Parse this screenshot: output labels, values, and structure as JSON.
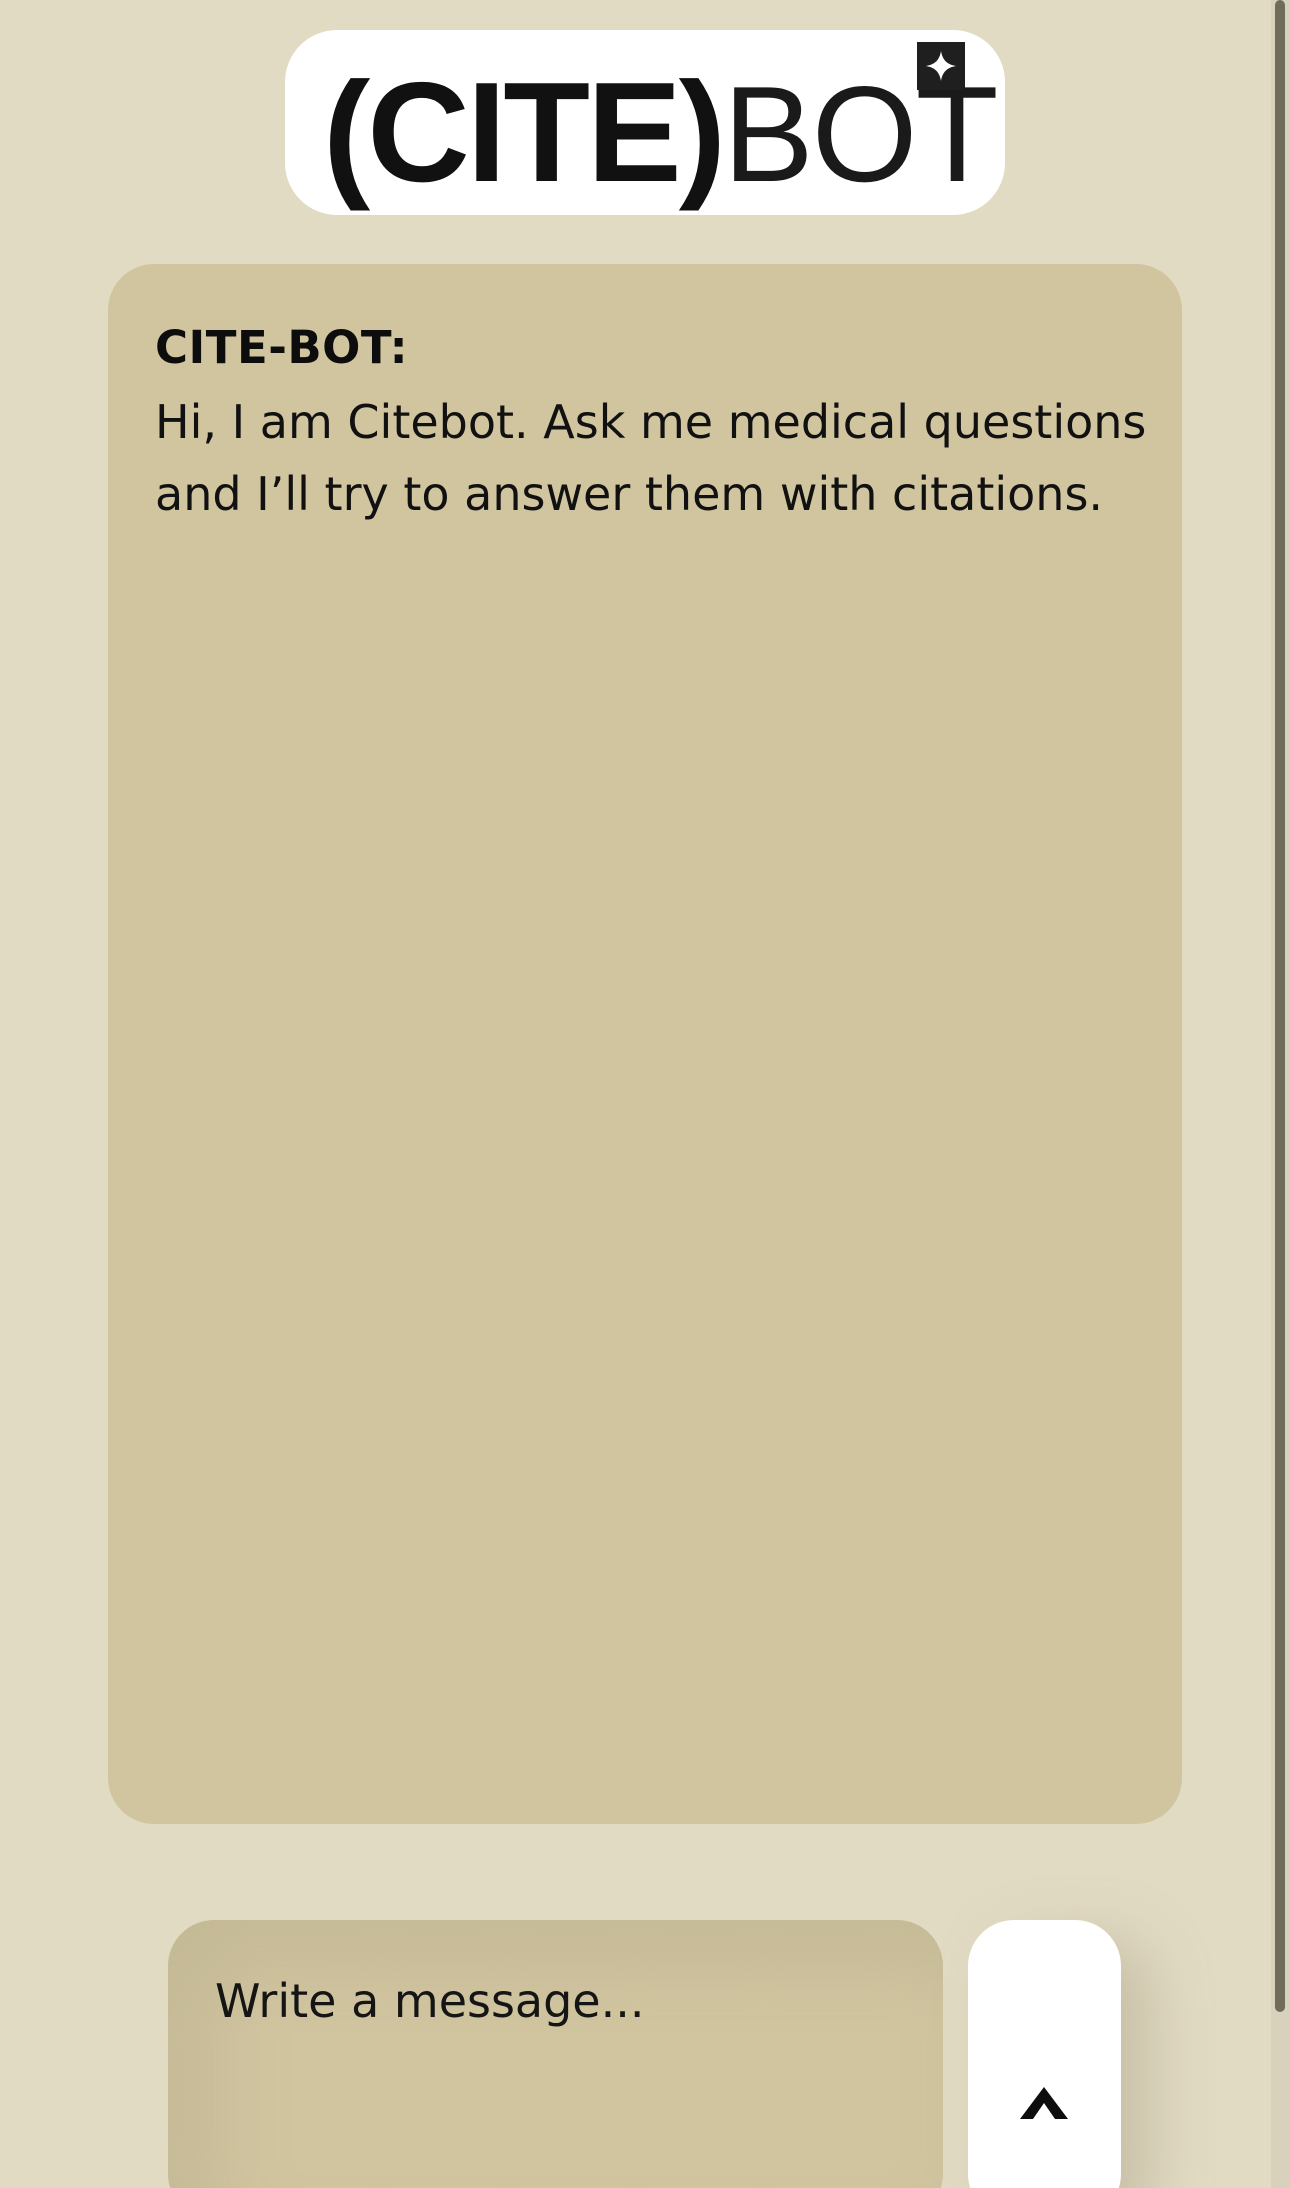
{
  "logo": {
    "bold_text": "(CITE)",
    "light_text": "BOT",
    "badge_icon": "sparkle-icon"
  },
  "chat": {
    "messages": [
      {
        "sender": "CITE-BOT:",
        "text": "Hi, I am Citebot. Ask me medical questions and I’ll try to answer them with citations."
      }
    ]
  },
  "composer": {
    "placeholder": "Write a message...",
    "value": "",
    "send_icon": "caret-up-icon"
  },
  "colors": {
    "background": "#e2dbc4",
    "panel": "#d1c5a0",
    "logo_bg": "#ffffff",
    "text": "#111111"
  }
}
